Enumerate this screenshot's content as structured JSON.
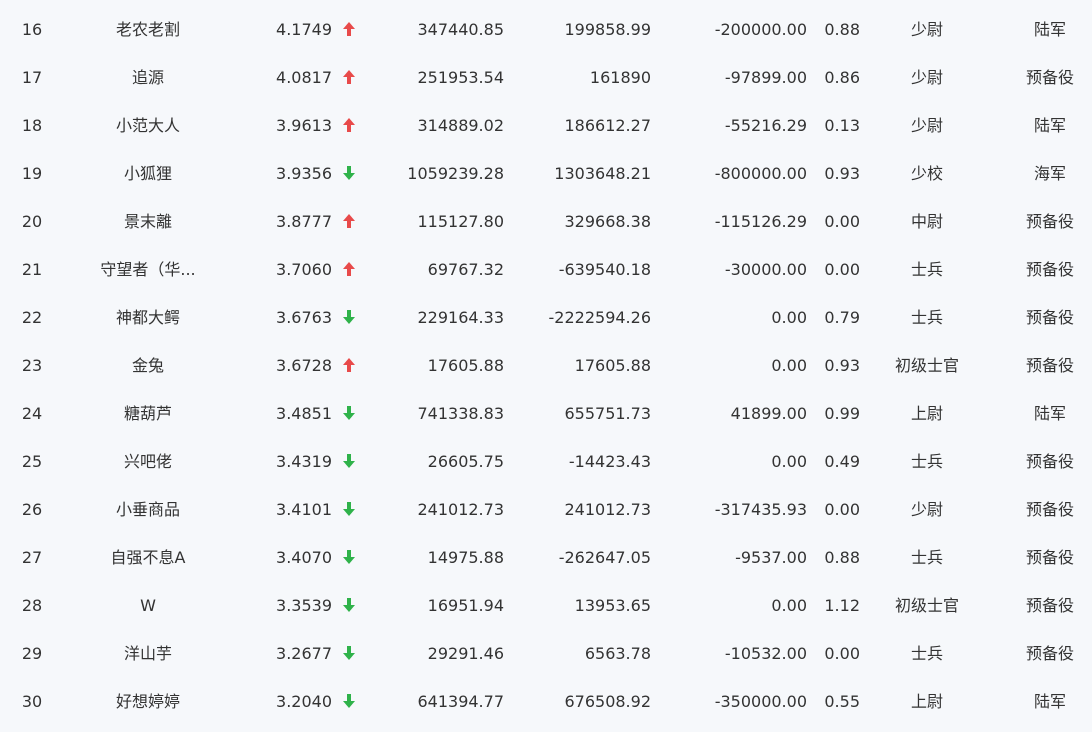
{
  "colors": {
    "up": "#e84a4a",
    "down": "#2fb24a",
    "text": "#333333",
    "background": "#f6f8fb"
  },
  "rows": [
    {
      "rank": "16",
      "name": "老农老割",
      "score": "4.1749",
      "trend": "up",
      "v1": "347440.85",
      "v2": "199858.99",
      "v3": "-200000.00",
      "ratio": "0.88",
      "title": "少尉",
      "branch": "陆军"
    },
    {
      "rank": "17",
      "name": "追源",
      "score": "4.0817",
      "trend": "up",
      "v1": "251953.54",
      "v2": "161890",
      "v3": "-97899.00",
      "ratio": "0.86",
      "title": "少尉",
      "branch": "预备役"
    },
    {
      "rank": "18",
      "name": "小范大人",
      "score": "3.9613",
      "trend": "up",
      "v1": "314889.02",
      "v2": "186612.27",
      "v3": "-55216.29",
      "ratio": "0.13",
      "title": "少尉",
      "branch": "陆军"
    },
    {
      "rank": "19",
      "name": "小狐狸",
      "score": "3.9356",
      "trend": "down",
      "v1": "1059239.28",
      "v2": "1303648.21",
      "v3": "-800000.00",
      "ratio": "0.93",
      "title": "少校",
      "branch": "海军"
    },
    {
      "rank": "20",
      "name": "景末離",
      "score": "3.8777",
      "trend": "up",
      "v1": "115127.80",
      "v2": "329668.38",
      "v3": "-115126.29",
      "ratio": "0.00",
      "title": "中尉",
      "branch": "预备役"
    },
    {
      "rank": "21",
      "name": "守望者（华...",
      "score": "3.7060",
      "trend": "up",
      "v1": "69767.32",
      "v2": "-639540.18",
      "v3": "-30000.00",
      "ratio": "0.00",
      "title": "士兵",
      "branch": "预备役"
    },
    {
      "rank": "22",
      "name": "神都大鳄",
      "score": "3.6763",
      "trend": "down",
      "v1": "229164.33",
      "v2": "-2222594.26",
      "v3": "0.00",
      "ratio": "0.79",
      "title": "士兵",
      "branch": "预备役"
    },
    {
      "rank": "23",
      "name": "金兔",
      "score": "3.6728",
      "trend": "up",
      "v1": "17605.88",
      "v2": "17605.88",
      "v3": "0.00",
      "ratio": "0.93",
      "title": "初级士官",
      "branch": "预备役"
    },
    {
      "rank": "24",
      "name": "糖葫芦",
      "score": "3.4851",
      "trend": "down",
      "v1": "741338.83",
      "v2": "655751.73",
      "v3": "41899.00",
      "ratio": "0.99",
      "title": "上尉",
      "branch": "陆军"
    },
    {
      "rank": "25",
      "name": "兴吧佬",
      "score": "3.4319",
      "trend": "down",
      "v1": "26605.75",
      "v2": "-14423.43",
      "v3": "0.00",
      "ratio": "0.49",
      "title": "士兵",
      "branch": "预备役"
    },
    {
      "rank": "26",
      "name": "小垂商品",
      "score": "3.4101",
      "trend": "down",
      "v1": "241012.73",
      "v2": "241012.73",
      "v3": "-317435.93",
      "ratio": "0.00",
      "title": "少尉",
      "branch": "预备役"
    },
    {
      "rank": "27",
      "name": "自强不息A",
      "score": "3.4070",
      "trend": "down",
      "v1": "14975.88",
      "v2": "-262647.05",
      "v3": "-9537.00",
      "ratio": "0.88",
      "title": "士兵",
      "branch": "预备役"
    },
    {
      "rank": "28",
      "name": "W",
      "score": "3.3539",
      "trend": "down",
      "v1": "16951.94",
      "v2": "13953.65",
      "v3": "0.00",
      "ratio": "1.12",
      "title": "初级士官",
      "branch": "预备役"
    },
    {
      "rank": "29",
      "name": "洋山芋",
      "score": "3.2677",
      "trend": "down",
      "v1": "29291.46",
      "v2": "6563.78",
      "v3": "-10532.00",
      "ratio": "0.00",
      "title": "士兵",
      "branch": "预备役"
    },
    {
      "rank": "30",
      "name": "好想婷婷",
      "score": "3.2040",
      "trend": "down",
      "v1": "641394.77",
      "v2": "676508.92",
      "v3": "-350000.00",
      "ratio": "0.55",
      "title": "上尉",
      "branch": "陆军"
    }
  ]
}
